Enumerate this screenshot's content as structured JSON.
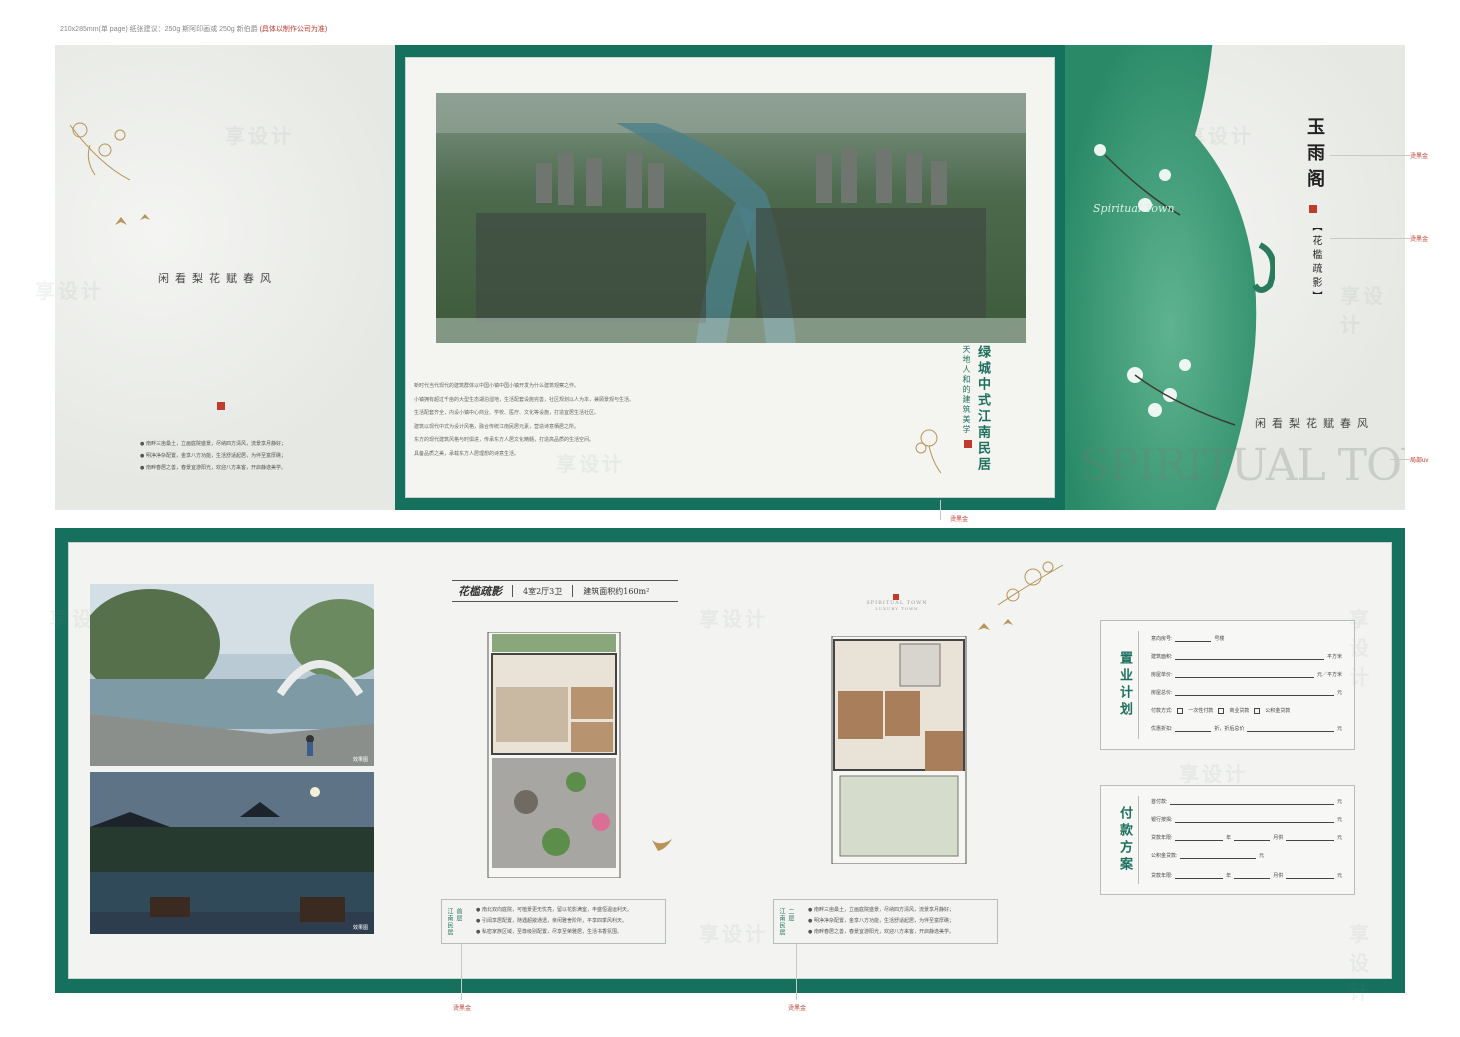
{
  "spec": {
    "text": "210x285mm(单 page) 纸张建议：250g 斯阿印画或 250g 新伯爵",
    "warn": "(具体以制作公司为准)"
  },
  "left_panel": {
    "tagline": "闲看梨花赋春风",
    "bullets": [
      "● 南畔三亩桑土，立画庭院盛景，尽纳四方清风，流景享月静好；",
      "● 明净净杂配置，金享八方功能，生活舒适起居，为伴至富厚礁；",
      "● 南畔春居之善，春景宜游阳光，欢迎八方来客，开启静逸美学。"
    ]
  },
  "center_panel": {
    "headline": "绿城中式江南民居",
    "subline": "天地人和的建筑美学",
    "body": [
      "新时代当代现代的建筑群体以中国小镇中国小镇开发为什么建筑观察之作。",
      "小镇拥有超过千亩的大型生态湖泊湿地，生活配套设施完善，社区规划以人为本，兼顾景观与生活。",
      "生活配套齐全，内设小镇中心商业、学校、医疗、文化等设施，打造宜居生活社区。",
      "建筑以现代中式为设计风格，融合传统江南民居元素，营造诗意栖居之所。",
      "东方的现代建筑风格与时俱进，传承东方人居文化精髓，打造高品质的生活空间。",
      "具备品质之美，承载东方人居理想的诗意生活。"
    ]
  },
  "right_panel": {
    "title": "玉雨阁",
    "subtitle": "【花槛疏影】",
    "script": "Spiritual Town",
    "tagline": "闲看梨花赋春风",
    "big_text": "SPIRITUAL TOWN"
  },
  "annotations": {
    "gold_foil": "烫黑金",
    "uv": "局部uv"
  },
  "watermark": "享设计",
  "floorplan": {
    "name": "花槛疏影",
    "rooms": "4室2厅3卫",
    "area": "建筑面积约160m²",
    "brand": "SPIRITUAL TOWN",
    "brand_sub": "LUXURY TOWN",
    "floor1_tag": "江南民居",
    "floor1_level": "首层",
    "floor2_tag": "江南民居",
    "floor2_level": "二层",
    "floor1_bullets": [
      "● 南北双向庭院，可植景更无忧亮，留以花影满室，丰盛恒温运利天。",
      "● 引阔享居配置，随遇超敞通透，亲闲雅舍阶所，平享四季风利天。",
      "● 私密家族区域，至尊级别配置，尽享至荣雅居，生活书香氛围。"
    ],
    "floor2_bullets": [
      "● 南畔三亩桑土，立画庭院盛景，尽纳四方清风，流景享月静好；",
      "● 明净净杂配置，金享八方功能，生活舒适起居，为伴至富厚礁；",
      "● 南畔春居之善，春景宜游阳光，欢迎八方来客，开启静逸美学。"
    ]
  },
  "photos": {
    "caption1": "效果图",
    "caption2": "效果图"
  },
  "plan_form": {
    "title": "置业计划",
    "rows": [
      {
        "label": "意向房号:",
        "suffix": "号楼"
      },
      {
        "label": "建筑面积:",
        "suffix": "平方米"
      },
      {
        "label": "房屋单价:",
        "suffix": "元／平方米"
      },
      {
        "label": "房屋总价:",
        "suffix": "元"
      },
      {
        "label": "付款方式:",
        "suffix": ""
      },
      {
        "label": "优惠折扣:",
        "suffix": "元"
      }
    ],
    "payment_options": [
      "一次性付款",
      "商业贷款",
      "公积金贷款"
    ],
    "discount_mid": "折，折后总价"
  },
  "pay_form": {
    "title": "付款方案",
    "rows": [
      {
        "label": "首付款:",
        "suffix": "元"
      },
      {
        "label": "银行按揭:",
        "suffix": "元"
      },
      {
        "label": "贷款年限:",
        "mid1": "年",
        "mid2": "月供",
        "suffix": "元"
      },
      {
        "label": "公积金贷款:",
        "suffix": "元"
      },
      {
        "label": "贷款年限:",
        "mid1": "年",
        "mid2": "月供",
        "suffix": "元"
      }
    ]
  }
}
